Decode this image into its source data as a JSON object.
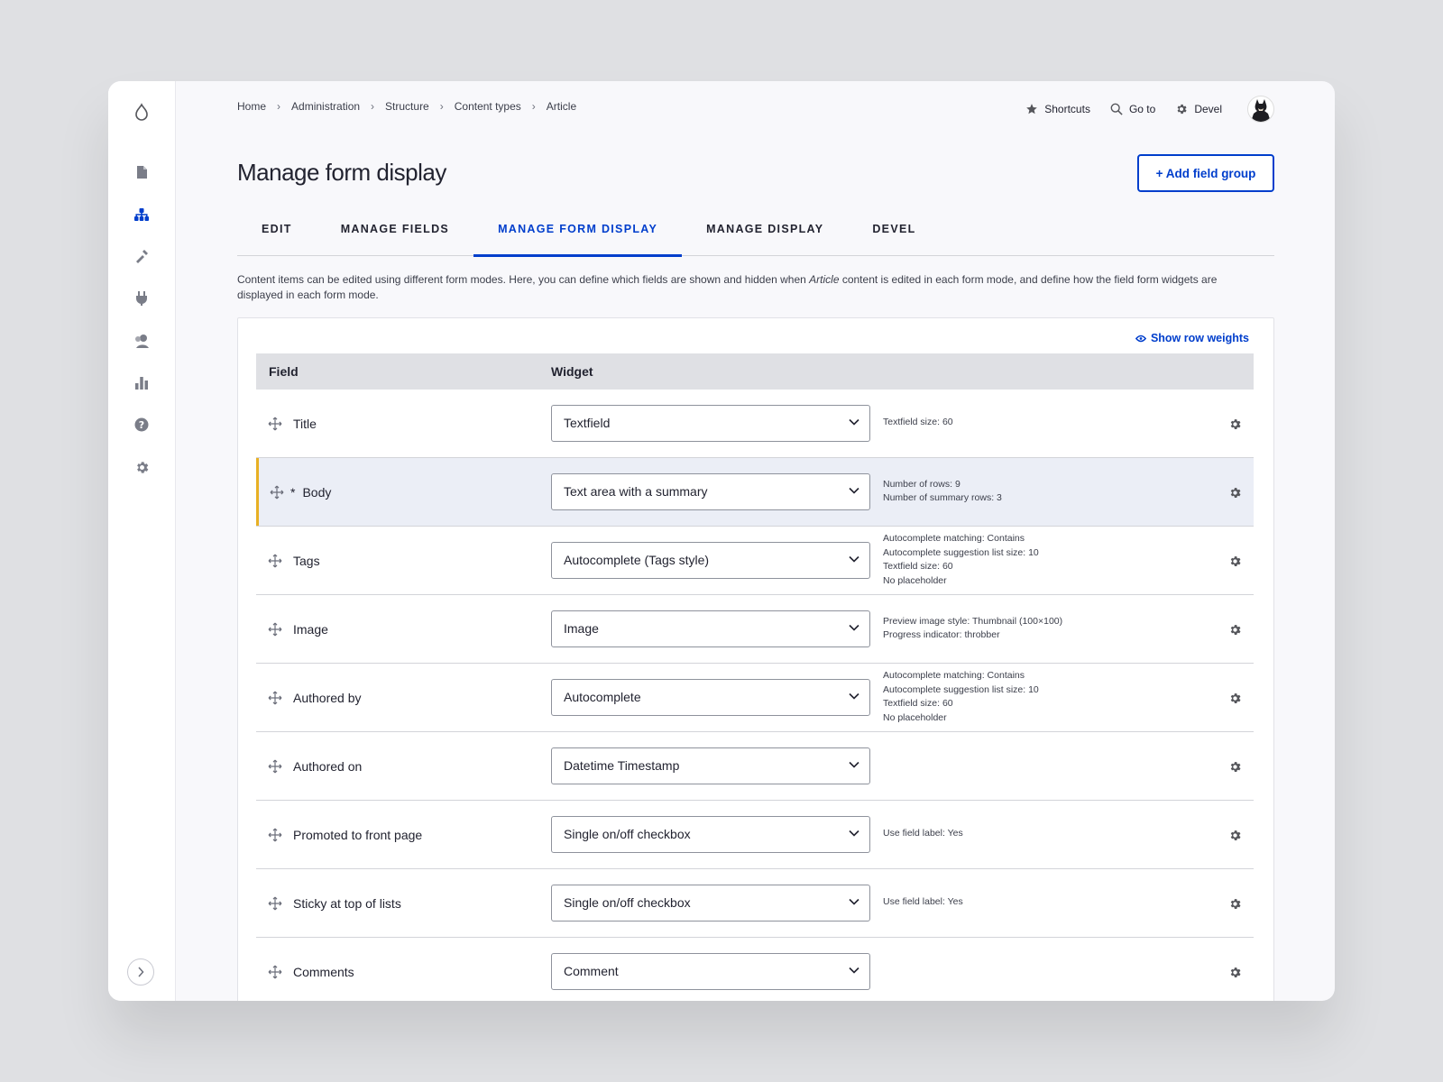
{
  "breadcrumb": [
    "Home",
    "Administration",
    "Structure",
    "Content types",
    "Article"
  ],
  "toolbar": {
    "shortcuts": "Shortcuts",
    "goto": "Go to",
    "devel": "Devel"
  },
  "page": {
    "title": "Manage form display",
    "add_button": "+ Add field group"
  },
  "tabs": [
    "EDIT",
    "MANAGE FIELDS",
    "MANAGE FORM DISPLAY",
    "MANAGE DISPLAY",
    "DEVEL"
  ],
  "active_tab": "MANAGE FORM DISPLAY",
  "description": {
    "before": "Content items can be edited using different form modes. Here, you can define which fields are shown and hidden when ",
    "emph": "Article",
    "after": " content is edited in each form mode, and define how the field form widgets are displayed in each form mode."
  },
  "table": {
    "show_weights": "Show row weights",
    "col_field": "Field",
    "col_widget": "Widget",
    "rows": [
      {
        "label": "Title",
        "widget": "Textfield",
        "summary": [
          "Textfield size: 60"
        ]
      },
      {
        "label": "Body",
        "required_marker": "*",
        "widget": "Text area with a summary",
        "summary": [
          "Number of rows: 9",
          "Number of summary rows: 3"
        ],
        "highlight": true
      },
      {
        "label": "Tags",
        "widget": "Autocomplete (Tags style)",
        "summary": [
          "Autocomplete matching: Contains",
          "Autocomplete suggestion list size: 10",
          "Textfield size: 60",
          "No placeholder"
        ]
      },
      {
        "label": "Image",
        "widget": "Image",
        "summary": [
          "Preview image style: Thumbnail (100×100)",
          "Progress indicator: throbber"
        ]
      },
      {
        "label": "Authored by",
        "widget": "Autocomplete",
        "summary": [
          "Autocomplete matching: Contains",
          "Autocomplete suggestion list size: 10",
          "Textfield size: 60",
          "No placeholder"
        ]
      },
      {
        "label": "Authored on",
        "widget": "Datetime Timestamp",
        "summary": []
      },
      {
        "label": "Promoted to front page",
        "widget": "Single on/off checkbox",
        "summary": [
          "Use field label: Yes"
        ]
      },
      {
        "label": "Sticky at top of lists",
        "widget": "Single on/off checkbox",
        "summary": [
          "Use field label: Yes"
        ]
      },
      {
        "label": "Comments",
        "widget": "Comment",
        "summary": []
      }
    ]
  },
  "sidebar": {
    "icons": [
      "drupal-logo-icon",
      "content-icon",
      "structure-icon",
      "appearance-icon",
      "extend-icon",
      "people-icon",
      "reports-icon",
      "help-icon",
      "configuration-icon"
    ],
    "active": "structure-icon"
  },
  "colors": {
    "accent": "#003ecc",
    "highlight_bar": "#e8b024",
    "header_bg": "#dfe0e4"
  }
}
